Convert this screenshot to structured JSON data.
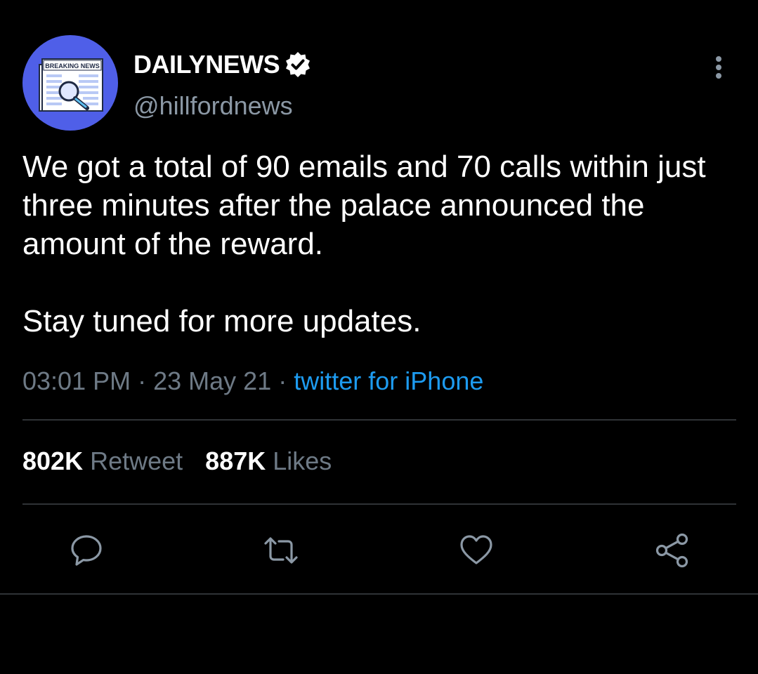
{
  "tweet": {
    "avatar": {
      "banner_text": "BREAKING NEWS",
      "background_color": "#4f5fe8"
    },
    "author": {
      "display_name": "DAILYNEWS",
      "handle": "@hillfordnews",
      "verified": true
    },
    "body": {
      "paragraph_1": "We got a total of 90 emails and 70 calls within just three minutes after the palace announced the amount of the reward.",
      "paragraph_2": "Stay tuned for more updates."
    },
    "meta": {
      "time": "03:01 PM",
      "separator": "·",
      "date": "23 May 21",
      "source": "twitter for iPhone"
    },
    "stats": {
      "retweet_count": "802K",
      "retweet_label": "Retweet",
      "likes_count": "887K",
      "likes_label": "Likes"
    },
    "actions": [
      "reply-icon",
      "retweet-icon",
      "like-icon",
      "share-icon"
    ]
  },
  "colors": {
    "background": "#000000",
    "text_primary": "#ffffff",
    "text_secondary": "#8b98a5",
    "link": "#1d9bf0",
    "divider": "#2f3336"
  }
}
